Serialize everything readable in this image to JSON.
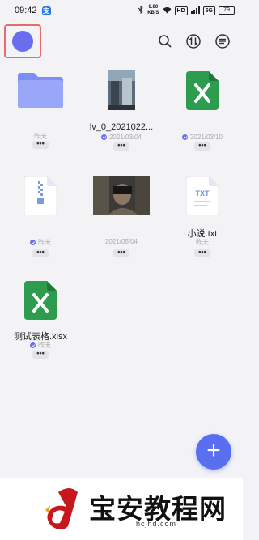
{
  "status_bar": {
    "time": "09:42",
    "app_badge": "支",
    "net_speed_value": "6.00",
    "net_speed_unit": "KB/S",
    "hd_label": "HD",
    "signal_label": "5G",
    "battery": "79"
  },
  "toolbar": {
    "icons": [
      "search-icon",
      "sort-icon",
      "menu-icon"
    ]
  },
  "files": [
    {
      "name": "",
      "meta": "昨天",
      "verified": false,
      "type": "folder"
    },
    {
      "name": "lv_0_2021022...",
      "meta": "2021/03/04",
      "verified": true,
      "type": "image"
    },
    {
      "name": "",
      "meta": "2021/03/10",
      "verified": true,
      "type": "excel"
    },
    {
      "name": "",
      "meta": "昨天",
      "verified": true,
      "type": "zip"
    },
    {
      "name": "",
      "meta": "2021/05/04",
      "verified": false,
      "type": "image"
    },
    {
      "name": "小说.txt",
      "meta": "昨天",
      "verified": false,
      "type": "txt"
    },
    {
      "name": "测试表格.xlsx",
      "meta": "昨天",
      "verified": true,
      "type": "excel"
    }
  ],
  "more_label": "•••",
  "fab_label": "+",
  "watermark": {
    "text": "宝安教程网",
    "url": "hcjhd.com"
  },
  "colors": {
    "accent": "#5a6ff0",
    "folder": "#7d8ef5",
    "excel": "#2e9c4f",
    "highlight_frame": "#e86a6f"
  }
}
